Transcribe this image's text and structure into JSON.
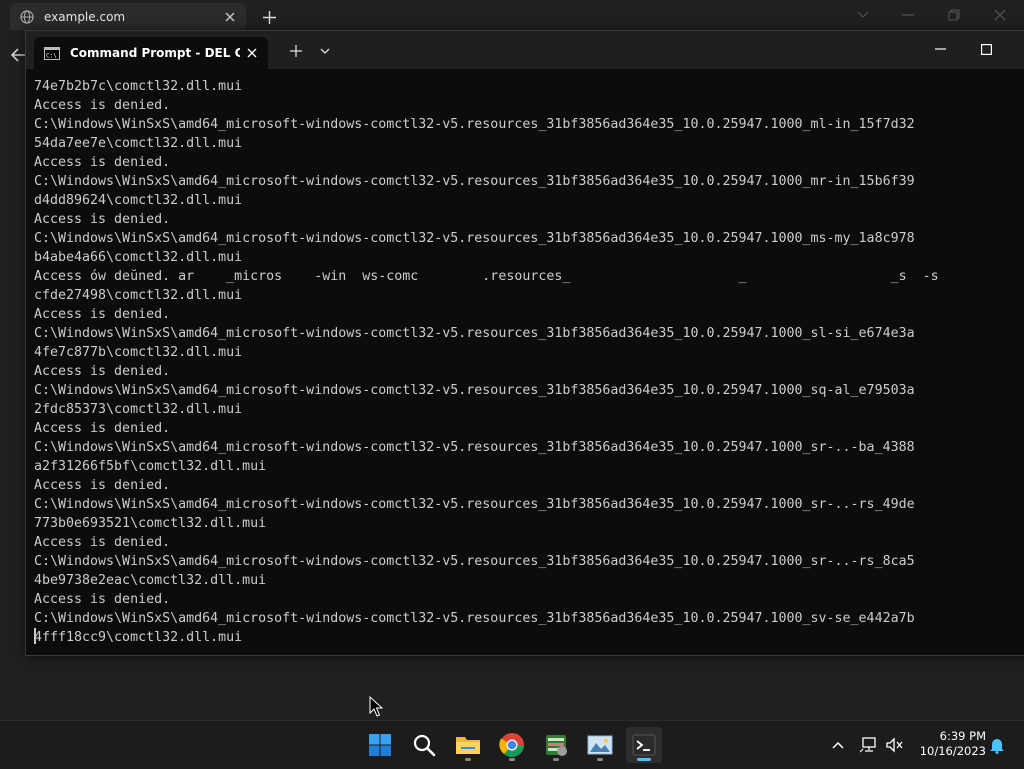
{
  "browser": {
    "tab_title": "example.com",
    "controls": [
      "chevron-down-icon",
      "minimize-icon",
      "restore-icon",
      "close-icon"
    ]
  },
  "terminal": {
    "tab_title": "Command Prompt - DEL  C:\\ /",
    "lines": [
      "74e7b2b7c\\comctl32.dll.mui",
      "Access is denied.",
      "C:\\Windows\\WinSxS\\amd64_microsoft-windows-comctl32-v5.resources_31bf3856ad364e35_10.0.25947.1000_ml-in_15f7d32",
      "54da7ee7e\\comctl32.dll.mui",
      "Access is denied.",
      "C:\\Windows\\WinSxS\\amd64_microsoft-windows-comctl32-v5.resources_31bf3856ad364e35_10.0.25947.1000_mr-in_15b6f39",
      "d4dd89624\\comctl32.dll.mui",
      "Access is denied.",
      "C:\\Windows\\WinSxS\\amd64_microsoft-windows-comctl32-v5.resources_31bf3856ad364e35_10.0.25947.1000_ms-my_1a8c978",
      "b4abe4a66\\comctl32.dll.mui",
      "Access ów deŭned. ar    _micros    -win  ws-comc        .resources_                     _                  _s  -s",
      "cfde27498\\comctl32.dll.mui",
      "Access is denied.",
      "C:\\Windows\\WinSxS\\amd64_microsoft-windows-comctl32-v5.resources_31bf3856ad364e35_10.0.25947.1000_sl-si_e674e3a",
      "4fe7c877b\\comctl32.dll.mui",
      "Access is denied.",
      "C:\\Windows\\WinSxS\\amd64_microsoft-windows-comctl32-v5.resources_31bf3856ad364e35_10.0.25947.1000_sq-al_e79503a",
      "2fdc85373\\comctl32.dll.mui",
      "Access is denied.",
      "C:\\Windows\\WinSxS\\amd64_microsoft-windows-comctl32-v5.resources_31bf3856ad364e35_10.0.25947.1000_sr-..-ba_4388",
      "a2f31266f5bf\\comctl32.dll.mui",
      "Access is denied.",
      "C:\\Windows\\WinSxS\\amd64_microsoft-windows-comctl32-v5.resources_31bf3856ad364e35_10.0.25947.1000_sr-..-rs_49de",
      "773b0e693521\\comctl32.dll.mui",
      "Access is denied.",
      "C:\\Windows\\WinSxS\\amd64_microsoft-windows-comctl32-v5.resources_31bf3856ad364e35_10.0.25947.1000_sr-..-rs_8ca5",
      "4be9738e2eac\\comctl32.dll.mui",
      "Access is denied.",
      "C:\\Windows\\WinSxS\\amd64_microsoft-windows-comctl32-v5.resources_31bf3856ad364e35_10.0.25947.1000_sv-se_e442a7b",
      "4fff18cc9\\comctl32.dll.mui"
    ]
  },
  "taskbar": {
    "apps": [
      {
        "name": "start-button",
        "icon": "windows-logo-icon",
        "active": false
      },
      {
        "name": "search-button",
        "icon": "search-icon",
        "active": false
      },
      {
        "name": "file-explorer-button",
        "icon": "folder-icon",
        "active": false
      },
      {
        "name": "chrome-button",
        "icon": "chrome-icon",
        "active": false
      },
      {
        "name": "task-manager-button",
        "icon": "task-manager-icon",
        "active": false
      },
      {
        "name": "image-viewer-button",
        "icon": "picture-icon",
        "active": false
      },
      {
        "name": "terminal-button",
        "icon": "terminal-icon",
        "active": true
      }
    ],
    "tray": {
      "time": "6:39 PM",
      "date": "10/16/2023"
    }
  },
  "colors": {
    "accent": "#4cc2ff",
    "terminal_bg": "#0c0c0c",
    "terminal_text": "#cccccc"
  }
}
